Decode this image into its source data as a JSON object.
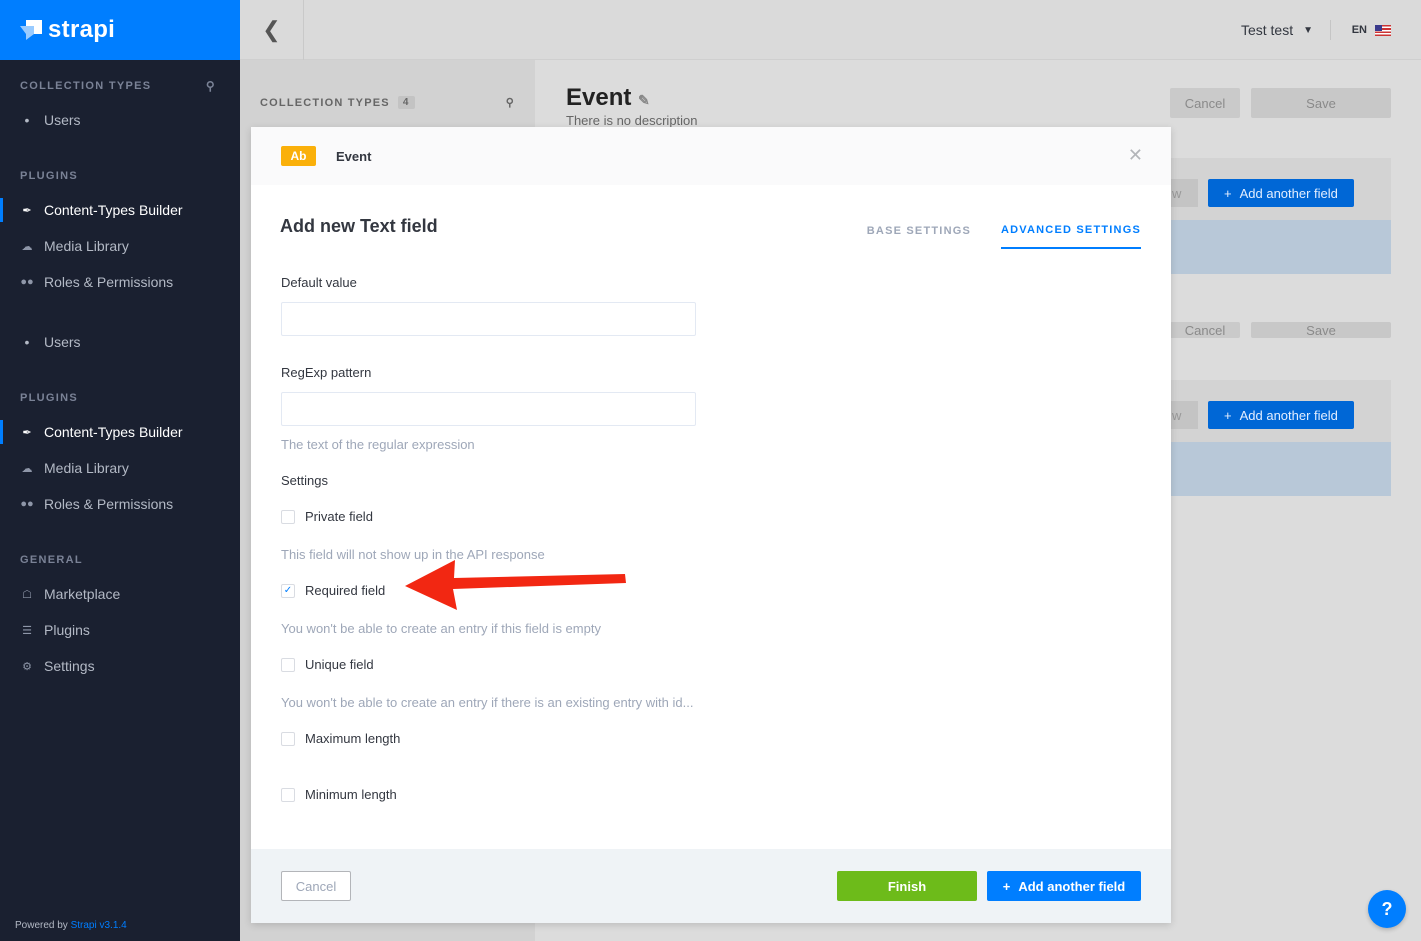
{
  "sidebar": {
    "brand": "strapi",
    "sections": [
      {
        "heading": "COLLECTION TYPES",
        "items": [
          {
            "label": "Users"
          }
        ]
      },
      {
        "heading": "PLUGINS",
        "items": [
          {
            "label": "Content-Types Builder"
          },
          {
            "label": "Media Library"
          },
          {
            "label": "Roles & Permissions"
          }
        ]
      },
      {
        "items": [
          {
            "label": "Users"
          }
        ]
      },
      {
        "heading": "PLUGINS",
        "items": [
          {
            "label": "Content-Types Builder"
          },
          {
            "label": "Media Library"
          },
          {
            "label": "Roles & Permissions"
          }
        ]
      },
      {
        "heading": "GENERAL",
        "items": [
          {
            "label": "Marketplace"
          },
          {
            "label": "Plugins"
          },
          {
            "label": "Settings"
          }
        ]
      }
    ],
    "powered_by": "Powered by",
    "version": "Strapi v3.1.4"
  },
  "topbar": {
    "user": "Test test",
    "lang": "EN"
  },
  "background": {
    "collection_heading": "COLLECTION TYPES",
    "collection_count": "4",
    "title": "Event",
    "description": "There is no description",
    "cancel": "Cancel",
    "save": "Save",
    "add_field": "Add another field",
    "partial": "w"
  },
  "modal": {
    "badge": "Ab",
    "type_name": "Event",
    "title": "Add new Text field",
    "tabs": [
      {
        "label": "BASE SETTINGS"
      },
      {
        "label": "ADVANCED SETTINGS"
      }
    ],
    "default_value_label": "Default value",
    "regexp_label": "RegExp pattern",
    "regexp_hint": "The text of the regular expression",
    "settings_label": "Settings",
    "options": [
      {
        "label": "Private field",
        "checked": false,
        "hint": "This field will not show up in the API response"
      },
      {
        "label": "Required field",
        "checked": true,
        "hint": "You won't be able to create an entry if this field is empty"
      },
      {
        "label": "Unique field",
        "checked": false,
        "hint": "You won't be able to create an entry if there is an existing entry with id..."
      },
      {
        "label": "Maximum length",
        "checked": false
      },
      {
        "label": "Minimum length",
        "checked": false
      }
    ],
    "footer": {
      "cancel": "Cancel",
      "finish": "Finish",
      "add_another": "Add another field"
    }
  },
  "colors": {
    "primary": "#007eff",
    "finish": "#6dbb1a",
    "badge": "#fab00a",
    "sidebar": "#1a2030",
    "annotation_arrow": "#f22712"
  }
}
